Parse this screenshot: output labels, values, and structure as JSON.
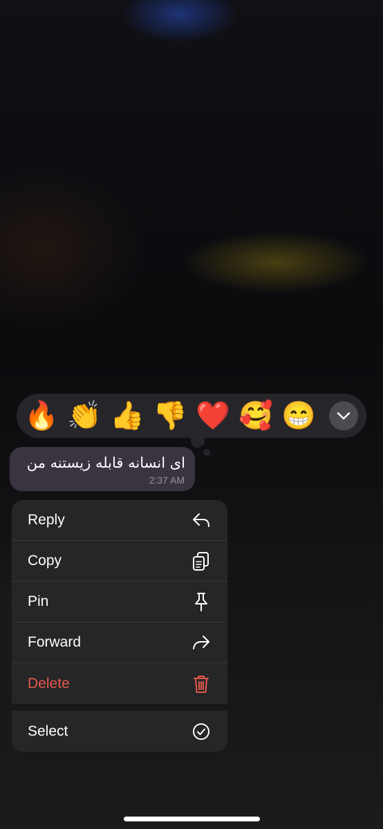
{
  "reactions": [
    {
      "name": "fire",
      "emoji": "🔥"
    },
    {
      "name": "clapping-hands",
      "emoji": "👏"
    },
    {
      "name": "thumbs-up",
      "emoji": "👍"
    },
    {
      "name": "thumbs-down",
      "emoji": "👎"
    },
    {
      "name": "red-heart",
      "emoji": "❤️"
    },
    {
      "name": "smiling-face-with-hearts",
      "emoji": "🥰"
    },
    {
      "name": "beaming-face",
      "emoji": "😁"
    }
  ],
  "expand_icon": "chevron-down-icon",
  "message": {
    "text": "ای انسانه قابله زیستنه من",
    "time": "2:37 AM"
  },
  "menu": {
    "reply": {
      "label": "Reply",
      "icon": "reply-icon"
    },
    "copy": {
      "label": "Copy",
      "icon": "copy-icon"
    },
    "pin": {
      "label": "Pin",
      "icon": "pin-icon"
    },
    "forward": {
      "label": "Forward",
      "icon": "forward-icon"
    },
    "delete": {
      "label": "Delete",
      "icon": "trash-icon",
      "color": "#e5594b"
    },
    "select": {
      "label": "Select",
      "icon": "check-circle-icon"
    }
  },
  "colors": {
    "menu_background": "#262628",
    "bubble_background": "#3a3340",
    "danger": "#e5594b"
  }
}
